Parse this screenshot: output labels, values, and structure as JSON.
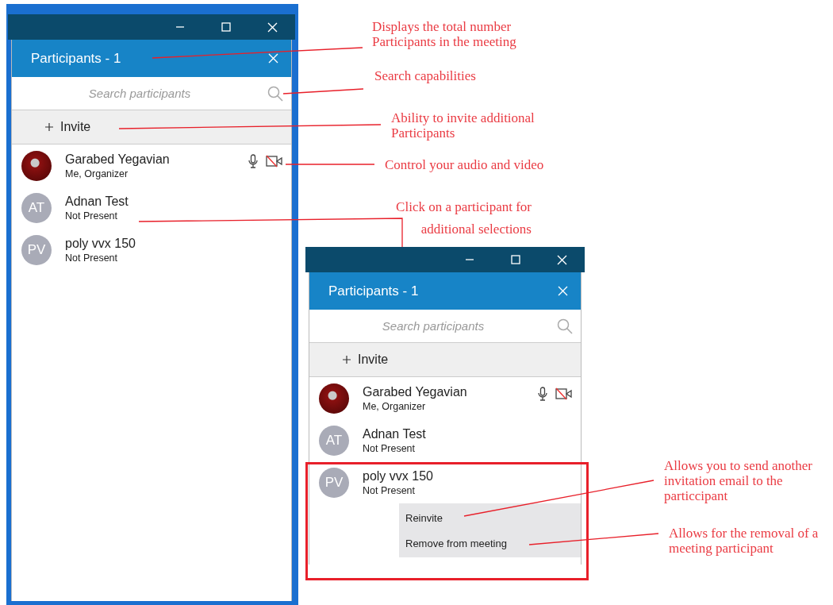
{
  "windows": [
    {
      "title": "Participants - 1",
      "search": {
        "placeholder": "Search participants"
      },
      "invite": "Invite",
      "participants": [
        {
          "name": "Garabed Yegavian",
          "status": "Me, Organizer",
          "avatar": {
            "kind": "photo"
          },
          "controls": {
            "video_off": true
          }
        },
        {
          "name": "Adnan Test",
          "status": "Not Present",
          "avatar": {
            "kind": "initials",
            "text": "AT"
          }
        },
        {
          "name": "poly vvx 150",
          "status": "Not Present",
          "avatar": {
            "kind": "initials",
            "text": "PV"
          }
        }
      ]
    },
    {
      "title": "Participants - 1",
      "search": {
        "placeholder": "Search participants"
      },
      "invite": "Invite",
      "participants": [
        {
          "name": "Garabed Yegavian",
          "status": "Me, Organizer",
          "avatar": {
            "kind": "photo"
          },
          "controls": {
            "video_off": true
          }
        },
        {
          "name": "Adnan Test",
          "status": "Not Present",
          "avatar": {
            "kind": "initials",
            "text": "AT"
          }
        },
        {
          "name": "poly vvx 150",
          "status": "Not Present",
          "avatar": {
            "kind": "initials",
            "text": "PV"
          },
          "menu": [
            "Reinvite",
            "Remove from meeting"
          ]
        }
      ]
    }
  ],
  "annotations": [
    {
      "text": "Displays the total number Participants in the meeting"
    },
    {
      "text": "Search capabilities"
    },
    {
      "text": "Ability to invite additional Participants"
    },
    {
      "text": "Control your audio and video"
    },
    {
      "text": "Click on a participant for additional selections"
    },
    {
      "text": "Allows you to send another invitation email to the particcipant"
    },
    {
      "text": "Allows for the removal of a meeting participant"
    }
  ]
}
